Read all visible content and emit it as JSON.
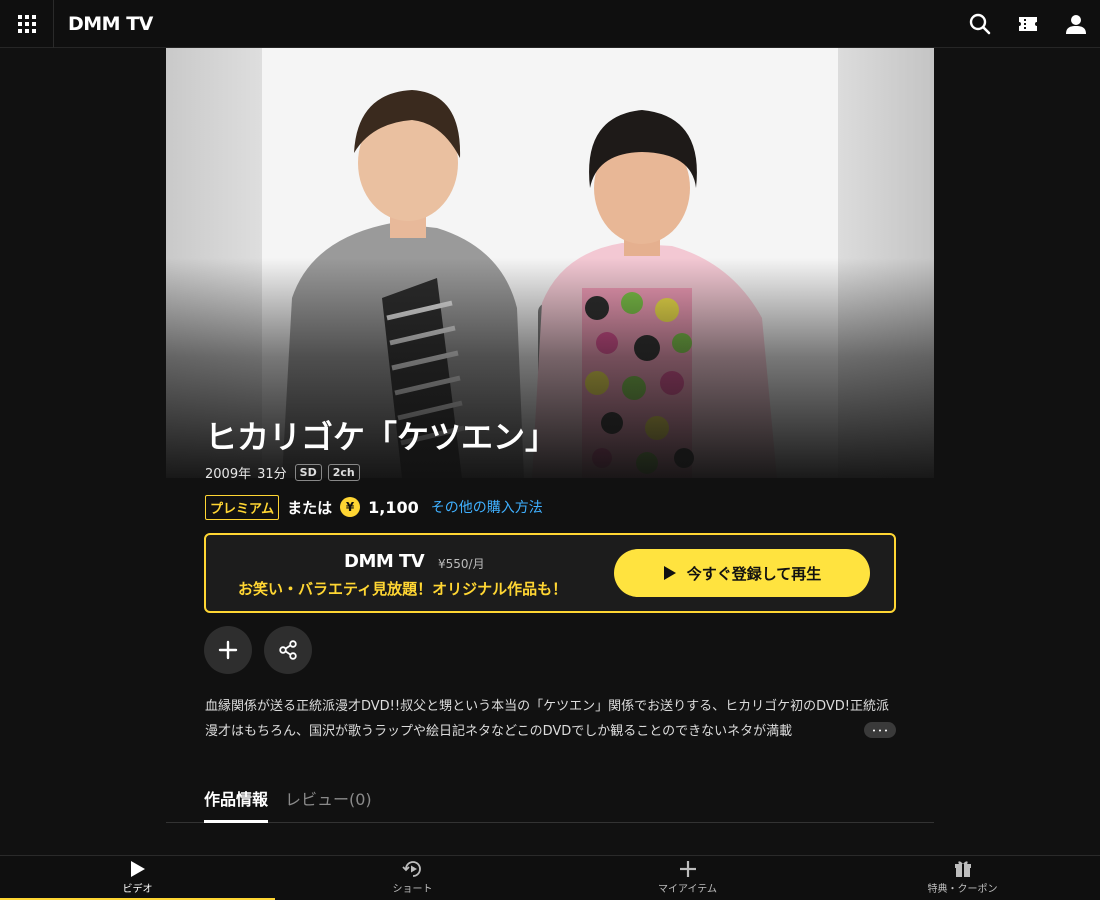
{
  "header": {
    "logo": "DMM TV",
    "menu_icon": "grid-icon",
    "search_icon": "search-icon",
    "ticket_icon": "ticket-icon",
    "user_icon": "user-icon"
  },
  "title": {
    "text": "ヒカリゴケ「ケツエン」",
    "year": "2009年",
    "duration": "31分",
    "tags": [
      "SD",
      "2ch"
    ]
  },
  "price": {
    "premium_label": "プレミアム",
    "or_label": "または",
    "yen_symbol": "¥",
    "amount": "1,100",
    "other_link": "その他の購入方法"
  },
  "promo": {
    "logo": "DMM TV",
    "price_label": "¥550/月",
    "copy": "お笑い・バラエティ見放題！オリジナル作品も！",
    "cta_label": "今すぐ登録して再生"
  },
  "actions": {
    "add_icon": "plus-icon",
    "share_icon": "share-icon"
  },
  "description": {
    "text": "血縁関係が送る正統派漫才DVD!!叔父と甥という本当の「ケツエン」関係でお送りする、ヒカリゴケ初のDVD!正統派漫才はもちろん、国沢が歌うラップや絵日記ネタなどこのDVDでしか観ることのできないネタが満載",
    "more_label": "･･･"
  },
  "tabs": [
    {
      "label": "作品情報",
      "active": true
    },
    {
      "label": "レビュー(0)",
      "active": false
    }
  ],
  "bottom_nav": [
    {
      "label": "ビデオ",
      "icon": "play-icon",
      "active": true
    },
    {
      "label": "ショート",
      "icon": "shorts-icon",
      "active": false
    },
    {
      "label": "マイアイテム",
      "icon": "plus-icon",
      "active": false
    },
    {
      "label": "特典・クーポン",
      "icon": "gift-icon",
      "active": false
    }
  ],
  "colors": {
    "accent": "#ffd633",
    "cta": "#ffe33f",
    "link": "#3fb0ff",
    "background": "#111111"
  }
}
